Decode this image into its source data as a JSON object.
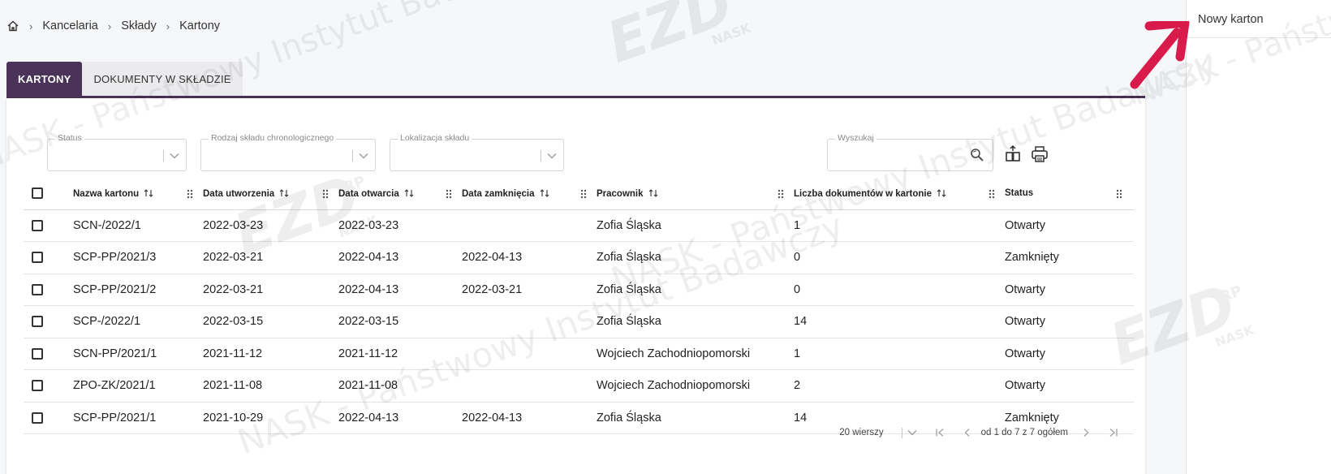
{
  "breadcrumb": {
    "items": [
      "Kancelaria",
      "Składy",
      "Kartony"
    ]
  },
  "tabs": [
    {
      "label": "KARTONY",
      "active": true
    },
    {
      "label": "DOKUMENTY W SKŁADZIE",
      "active": false
    }
  ],
  "filters": {
    "status": {
      "label": "Status",
      "value": ""
    },
    "rodzaj": {
      "label": "Rodzaj składu chronologicznego",
      "value": ""
    },
    "lokalizacja": {
      "label": "Lokalizacja składu",
      "value": ""
    },
    "search": {
      "label": "Wyszukaj",
      "value": ""
    }
  },
  "table": {
    "columns": [
      "Nazwa kartonu",
      "Data utworzenia",
      "Data otwarcia",
      "Data zamknięcia",
      "Pracownik",
      "Liczba dokumentów w kartonie",
      "Status"
    ],
    "rows": [
      [
        "SCN-/2022/1",
        "2022-03-23",
        "2022-03-23",
        "",
        "Zofia Śląska",
        "1",
        "Otwarty"
      ],
      [
        "SCP-PP/2021/3",
        "2022-03-21",
        "2022-04-13",
        "2022-04-13",
        "Zofia Śląska",
        "0",
        "Zamknięty"
      ],
      [
        "SCP-PP/2021/2",
        "2022-03-21",
        "2022-04-13",
        "2022-03-21",
        "Zofia Śląska",
        "0",
        "Otwarty"
      ],
      [
        "SCP-/2022/1",
        "2022-03-15",
        "2022-03-15",
        "",
        "Zofia Śląska",
        "14",
        "Otwarty"
      ],
      [
        "SCN-PP/2021/1",
        "2021-11-12",
        "2021-11-12",
        "",
        "Wojciech Zachodniopomorski",
        "1",
        "Otwarty"
      ],
      [
        "ZPO-ZK/2021/1",
        "2021-11-08",
        "2021-11-08",
        "",
        "Wojciech Zachodniopomorski",
        "2",
        "Otwarty"
      ],
      [
        "SCP-PP/2021/1",
        "2021-10-29",
        "2022-04-13",
        "2022-04-13",
        "Zofia Śląska",
        "14",
        "Zamknięty"
      ]
    ]
  },
  "pager": {
    "rows_per_page": "20 wierszy",
    "range": "od 1 do 7 z 7 ogółem"
  },
  "side_panel": {
    "new_item": "Nowy karton"
  },
  "watermark": {
    "line1": "NASK - Państwowy Instytut Badawczy",
    "logo": "EZD",
    "logo_sup": "RP",
    "logo_sub": "NASK"
  },
  "colors": {
    "accent": "#4a3258",
    "annotation_arrow": "#d81b4a"
  },
  "icons": [
    "home-icon",
    "chevron-down-icon",
    "search-icon",
    "export-icon",
    "print-icon",
    "sort-icon",
    "drag-handle-icon",
    "first-page-icon",
    "prev-page-icon",
    "next-page-icon",
    "last-page-icon"
  ]
}
